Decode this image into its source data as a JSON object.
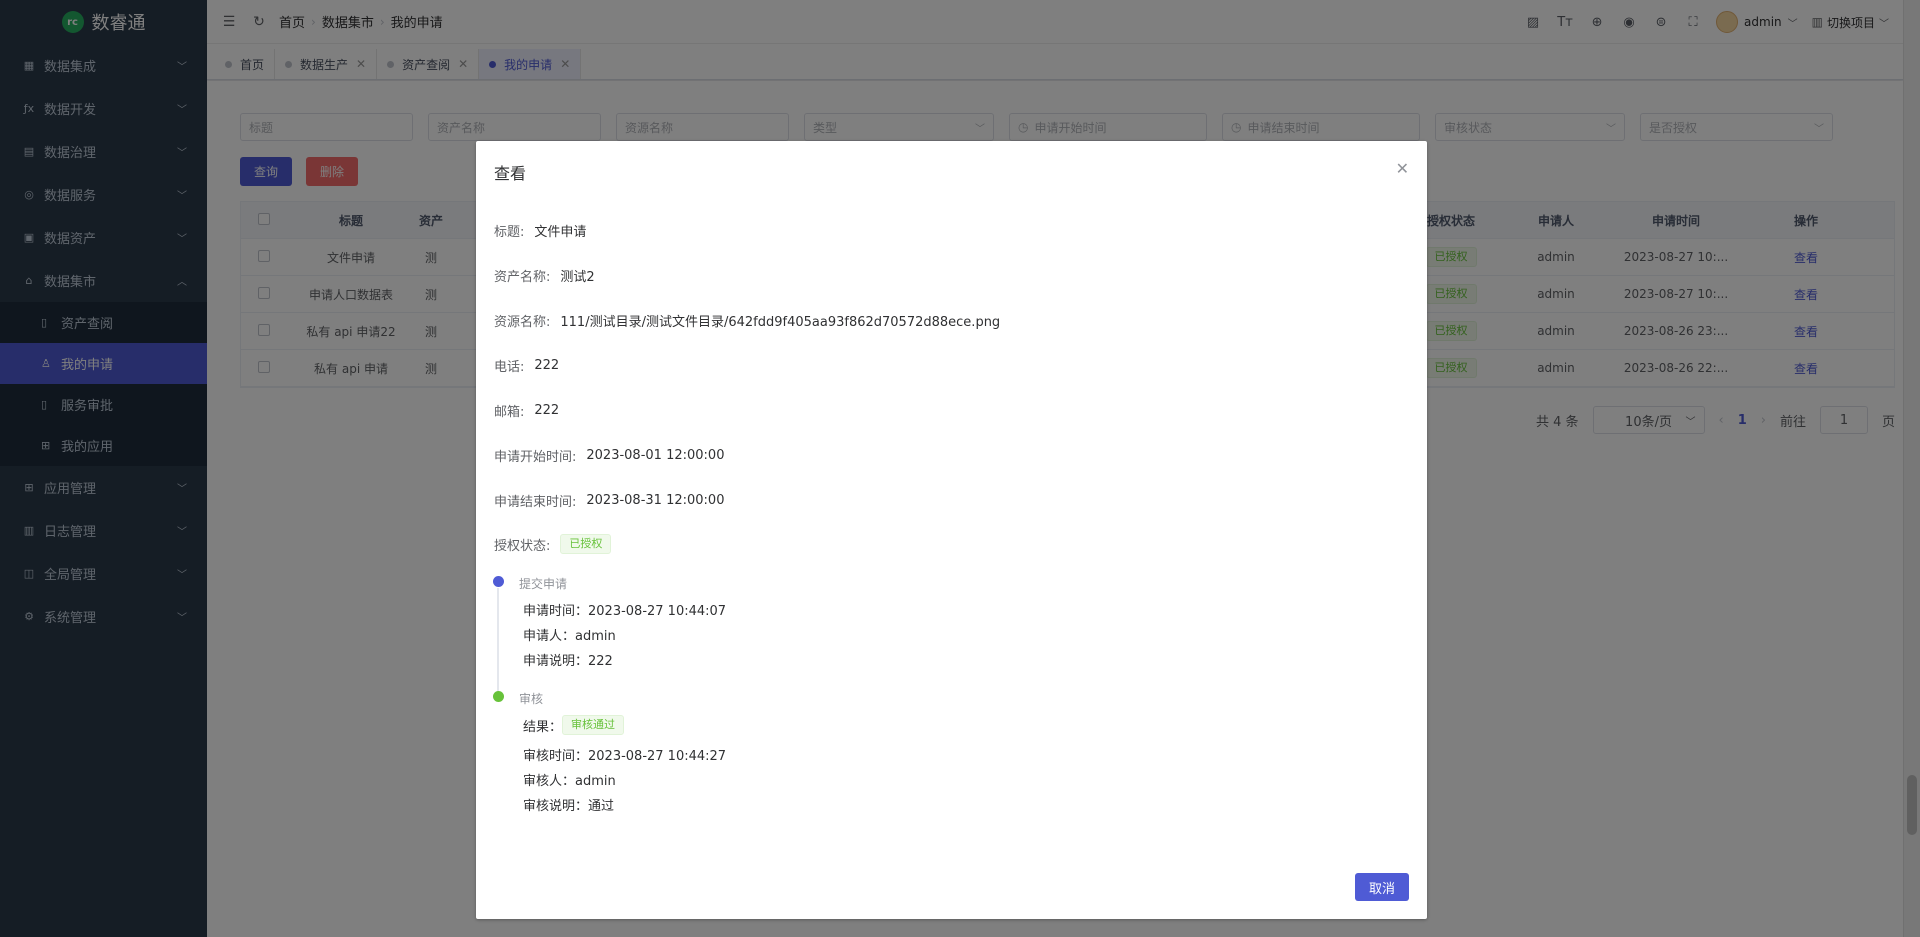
{
  "app": {
    "logo_text": "数睿通",
    "logo_mark": "rc"
  },
  "sidebar": {
    "items": [
      {
        "label": "数据集成",
        "icon": "grid-icon"
      },
      {
        "label": "数据开发",
        "icon": "fx-icon"
      },
      {
        "label": "数据治理",
        "icon": "table-icon"
      },
      {
        "label": "数据服务",
        "icon": "service-icon"
      },
      {
        "label": "数据资产",
        "icon": "asset-icon"
      },
      {
        "label": "数据集市",
        "icon": "market-icon"
      }
    ],
    "subitems": [
      {
        "label": "资产查阅",
        "icon": "doc-icon"
      },
      {
        "label": "我的申请",
        "icon": "user-icon"
      },
      {
        "label": "服务审批",
        "icon": "file-icon"
      },
      {
        "label": "我的应用",
        "icon": "apps-icon"
      }
    ],
    "items2": [
      {
        "label": "应用管理",
        "icon": "apps-icon"
      },
      {
        "label": "日志管理",
        "icon": "log-icon"
      },
      {
        "label": "全局管理",
        "icon": "global-icon"
      },
      {
        "label": "系统管理",
        "icon": "gear-icon"
      }
    ]
  },
  "navbar": {
    "breadcrumb": [
      "首页",
      "数据集市",
      "我的申请"
    ],
    "user": "admin",
    "switch_project": "切换项目"
  },
  "tabs": [
    {
      "label": "首页",
      "closable": false
    },
    {
      "label": "数据生产",
      "closable": true
    },
    {
      "label": "资产查阅",
      "closable": true
    },
    {
      "label": "我的申请",
      "closable": true,
      "active": true
    }
  ],
  "filters": {
    "title": "标题",
    "asset_name": "资产名称",
    "resource_name": "资源名称",
    "type": "类型",
    "start_time": "申请开始时间",
    "end_time": "申请结束时间",
    "review_status": "审核状态",
    "authorized": "是否授权"
  },
  "buttons": {
    "query": "查询",
    "delete": "删除"
  },
  "table": {
    "headers": {
      "title": "标题",
      "asset": "资产",
      "auth_status": "授权状态",
      "applicant": "申请人",
      "apply_time": "申请时间",
      "action": "操作"
    },
    "rows": [
      {
        "title": "文件申请",
        "asset": "测",
        "auth": "已授权",
        "applicant": "admin",
        "time": "2023-08-27 10:...",
        "action": "查看"
      },
      {
        "title": "申请人口数据表",
        "asset": "测",
        "auth": "已授权",
        "applicant": "admin",
        "time": "2023-08-27 10:...",
        "action": "查看"
      },
      {
        "title": "私有 api 申请22",
        "asset": "测",
        "auth": "已授权",
        "applicant": "admin",
        "time": "2023-08-26 23:...",
        "action": "查看"
      },
      {
        "title": "私有 api 申请",
        "asset": "测",
        "auth": "已授权",
        "applicant": "admin",
        "time": "2023-08-26 22:...",
        "action": "查看"
      }
    ]
  },
  "pagination": {
    "total": "共 4 条",
    "page_size": "10条/页",
    "current": "1",
    "goto_label": "前往",
    "goto_value": "1",
    "page_suffix": "页"
  },
  "dialog": {
    "title": "查看",
    "fields": [
      {
        "label": "标题:",
        "value": "文件申请"
      },
      {
        "label": "资产名称:",
        "value": "测试2"
      },
      {
        "label": "资源名称:",
        "value": "111/测试目录/测试文件目录/642fdd9f405aa93f862d70572d88ece.png"
      },
      {
        "label": "电话:",
        "value": "222"
      },
      {
        "label": "邮箱:",
        "value": "222"
      },
      {
        "label": "申请开始时间:",
        "value": "2023-08-01 12:00:00"
      },
      {
        "label": "申请结束时间:",
        "value": "2023-08-31 12:00:00"
      }
    ],
    "auth_label": "授权状态:",
    "auth_value": "已授权",
    "timeline": {
      "submit_title": "提交申请",
      "submit_time": "申请时间：2023-08-27 10:44:07",
      "submit_user": "申请人：admin",
      "submit_desc": "申请说明：222",
      "review_title": "审核",
      "result_label": "结果：",
      "result_value": "审核通过",
      "review_time": "审核时间：2023-08-27 10:44:27",
      "review_user": "审核人：admin",
      "review_desc": "审核说明：通过"
    },
    "cancel": "取消"
  },
  "colors": {
    "accent": "#4f5bd5",
    "danger": "#f56c6c",
    "success": "#67c23a",
    "sidebar": "#2b3a4a"
  }
}
